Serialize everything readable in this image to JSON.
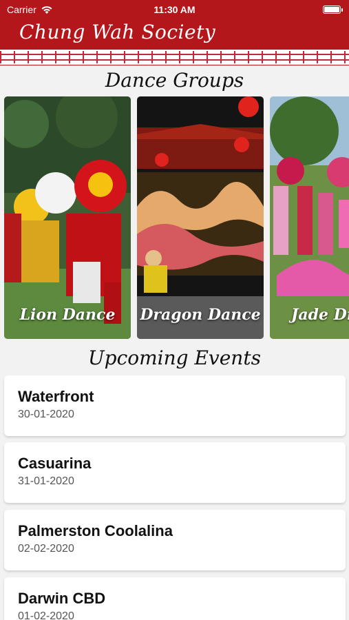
{
  "status_bar": {
    "carrier": "Carrier",
    "time": "11:30 AM",
    "icons": [
      "wifi-icon",
      "battery-icon"
    ]
  },
  "header": {
    "title": "Chung Wah Society",
    "background_color": "#b3171c"
  },
  "dance_groups": {
    "title": "Dance Groups",
    "items": [
      {
        "label": "Lion Dance",
        "image": "lion-dance-photo"
      },
      {
        "label": "Dragon Dance",
        "image": "dragon-dance-photo"
      },
      {
        "label": "Jade Drag",
        "image": "jade-dragon-photo"
      }
    ]
  },
  "events": {
    "title": "Upcoming Events",
    "items": [
      {
        "location": "Waterfront",
        "date": "30-01-2020"
      },
      {
        "location": "Casuarina",
        "date": "31-01-2020"
      },
      {
        "location": "Palmerston Coolalina",
        "date": "02-02-2020"
      },
      {
        "location": "Darwin CBD",
        "date": "01-02-2020"
      }
    ]
  }
}
